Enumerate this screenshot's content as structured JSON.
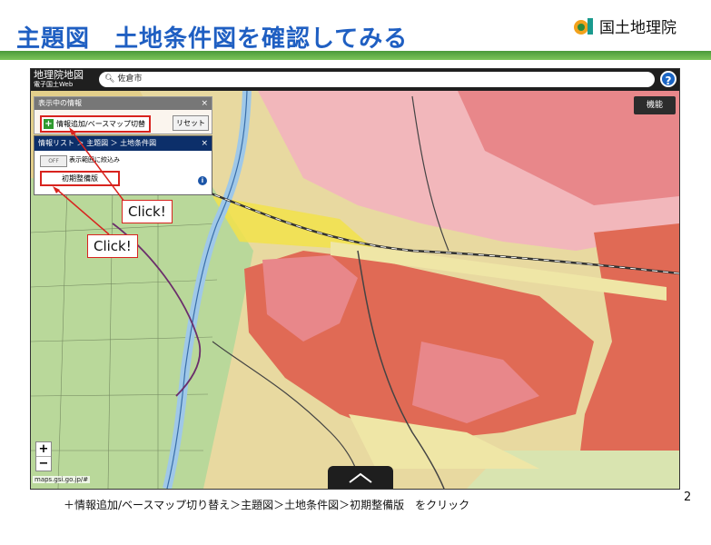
{
  "slide": {
    "title": "主題図　土地条件図を確認してみる",
    "caption": "＋情報追加/ベースマップ切り替え＞主題図＞土地条件図＞初期整備版　をクリック",
    "page_number": "2"
  },
  "gsi_logo": {
    "name": "国土地理院",
    "icon": "gsi-logo-mark"
  },
  "map": {
    "brand_line1": "地理院地図",
    "brand_line2": "電子国土Web",
    "search_value": "佐倉市",
    "help_label": "?",
    "function_button": "機能",
    "url": "maps.gsi.go.jp/#",
    "zoom_in": "+",
    "zoom_out": "−"
  },
  "panel_info": {
    "header": "表示中の情報",
    "add_button": "情報追加/ベースマップ切替",
    "reset_button": "リセット"
  },
  "panel_list": {
    "breadcrumb": "情報リスト ＞ 主題図 ＞ 土地条件図",
    "toggle_label": "OFF",
    "toggle_text": "表示範囲に絞込み",
    "initial_version": "初期整備版",
    "info_icon": "i"
  },
  "callouts": [
    "Click!",
    "Click!"
  ],
  "colors": {
    "title_blue": "#1f5fc2",
    "accent_red": "#d8231e",
    "map_terrace_pink": "#e8878a",
    "map_low_yellow": "#efe6a6",
    "map_green_plain": "#b9d89a",
    "river_blue": "#9fc8e8"
  }
}
